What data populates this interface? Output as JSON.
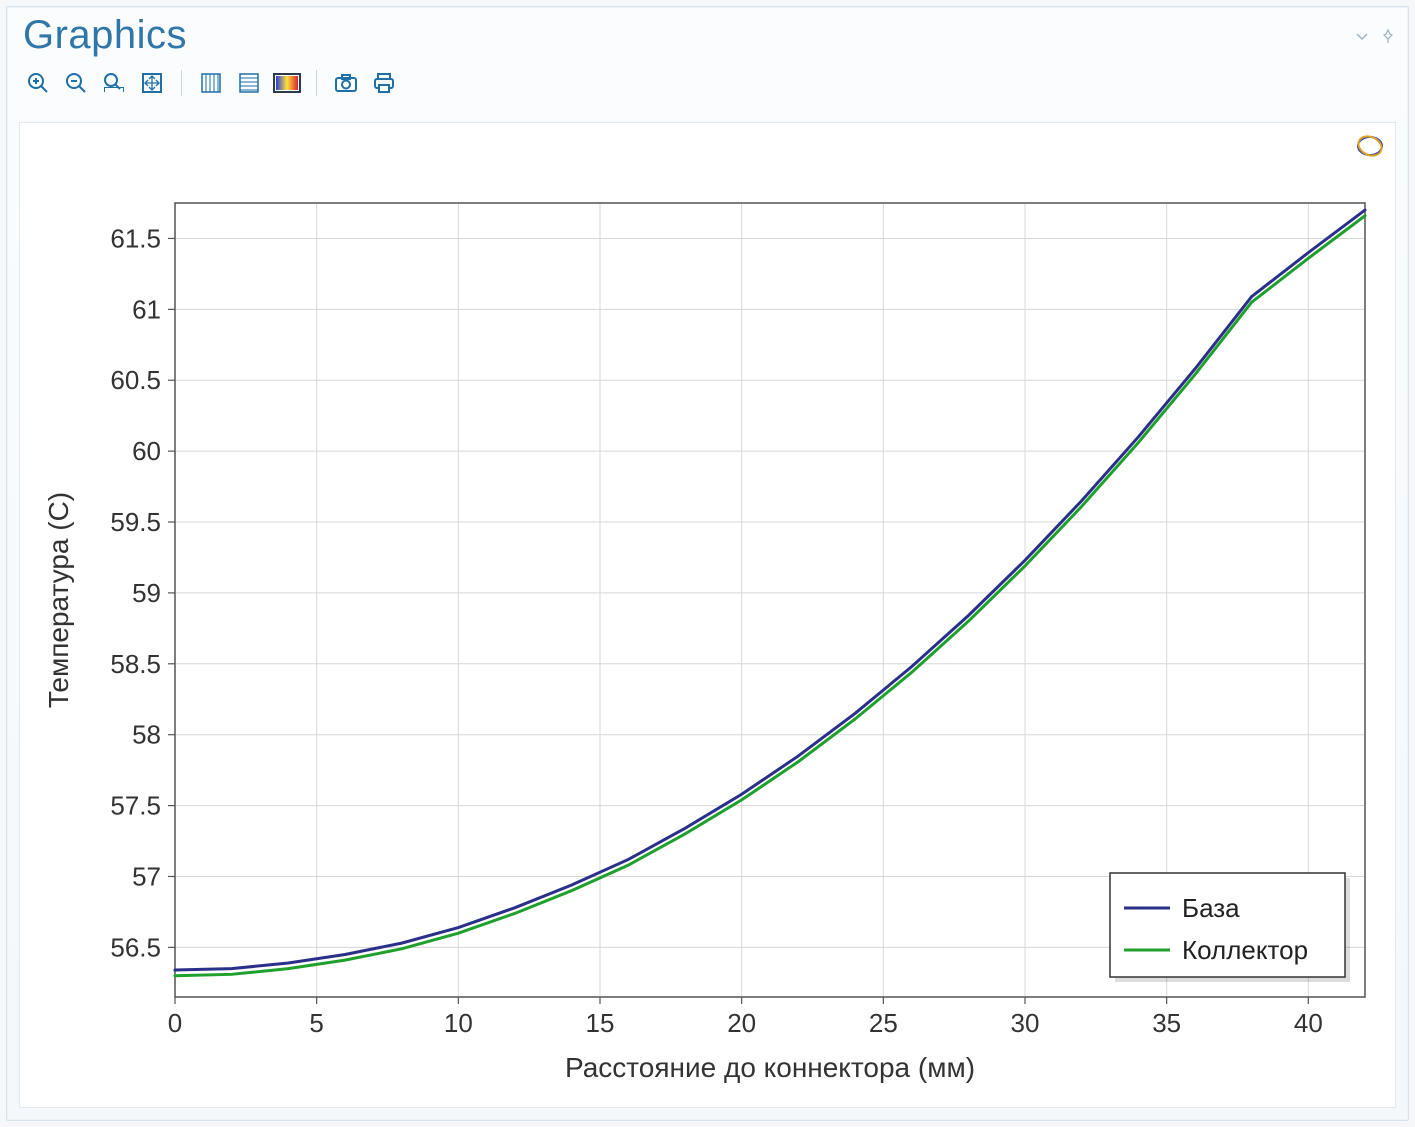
{
  "panel": {
    "title": "Graphics"
  },
  "toolbar": {
    "zoom_in": "zoom-in",
    "zoom_out": "zoom-out",
    "zoom_box": "zoom-box",
    "zoom_extents": "zoom-extents",
    "grid_v": "grid-vertical",
    "grid_h": "grid-horizontal",
    "colorbar": "colorbar",
    "snapshot": "snapshot",
    "print": "print"
  },
  "chart_data": {
    "type": "line",
    "xlabel": "Расстояние до коннектора (мм)",
    "ylabel": "Температура (C)",
    "xlim": [
      0,
      42
    ],
    "ylim": [
      56.15,
      61.75
    ],
    "xticks": [
      0,
      5,
      10,
      15,
      20,
      25,
      30,
      35,
      40
    ],
    "yticks": [
      56.5,
      57,
      57.5,
      58,
      58.5,
      59,
      59.5,
      60,
      60.5,
      61,
      61.5
    ],
    "grid": true,
    "legend_position": "bottom-right",
    "x": [
      0,
      2,
      4,
      6,
      8,
      10,
      12,
      14,
      16,
      18,
      20,
      22,
      24,
      26,
      28,
      30,
      32,
      34,
      36,
      38,
      40,
      42
    ],
    "series": [
      {
        "name": "База",
        "color": "#2a2f8a",
        "values": [
          56.34,
          56.35,
          56.39,
          56.45,
          56.53,
          56.64,
          56.78,
          56.94,
          57.12,
          57.34,
          57.58,
          57.85,
          58.15,
          58.48,
          58.84,
          59.23,
          59.65,
          60.1,
          60.58,
          61.09,
          61.4,
          61.7
        ]
      },
      {
        "name": "Коллектор",
        "color": "#1fa02c",
        "values": [
          56.3,
          56.31,
          56.35,
          56.41,
          56.49,
          56.6,
          56.74,
          56.9,
          57.08,
          57.3,
          57.54,
          57.81,
          58.11,
          58.44,
          58.8,
          59.19,
          59.61,
          60.06,
          60.54,
          61.05,
          61.36,
          61.66
        ]
      }
    ]
  }
}
